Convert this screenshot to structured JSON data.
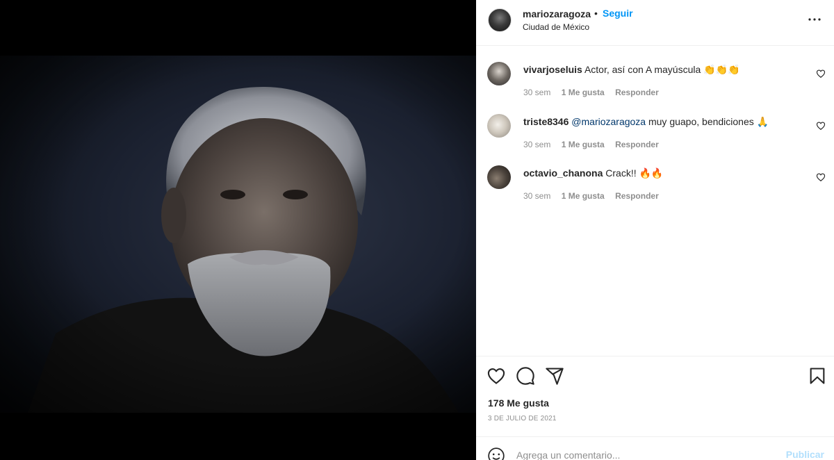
{
  "post": {
    "username": "mariozaragoza",
    "separator": "•",
    "follow_label": "Seguir",
    "location": "Ciudad de México"
  },
  "comments": [
    {
      "username": "vivarjoseluis",
      "mention": "",
      "text": "Actor, así con A mayúscula 👏👏👏",
      "time": "30 sem",
      "likes": "1 Me gusta",
      "reply": "Responder"
    },
    {
      "username": "triste8346",
      "mention": "@mariozaragoza",
      "text": "muy guapo, bendiciones 🙏",
      "time": "30 sem",
      "likes": "1 Me gusta",
      "reply": "Responder"
    },
    {
      "username": "octavio_chanona",
      "mention": "",
      "text": "Crack!! 🔥🔥",
      "time": "30 sem",
      "likes": "1 Me gusta",
      "reply": "Responder"
    }
  ],
  "stats": {
    "likes": "178 Me gusta",
    "date": "3 DE JULIO DE 2021"
  },
  "composer": {
    "placeholder": "Agrega un comentario...",
    "publish_label": "Publicar"
  },
  "colors": {
    "accent": "#0095f6",
    "publish_disabled": "#b2dffc",
    "secondary_text": "#8e8e8e"
  },
  "icons": [
    "more-options-icon",
    "heart-icon",
    "comment-icon",
    "share-icon",
    "bookmark-icon",
    "emoji-icon",
    "small-heart-icon"
  ]
}
